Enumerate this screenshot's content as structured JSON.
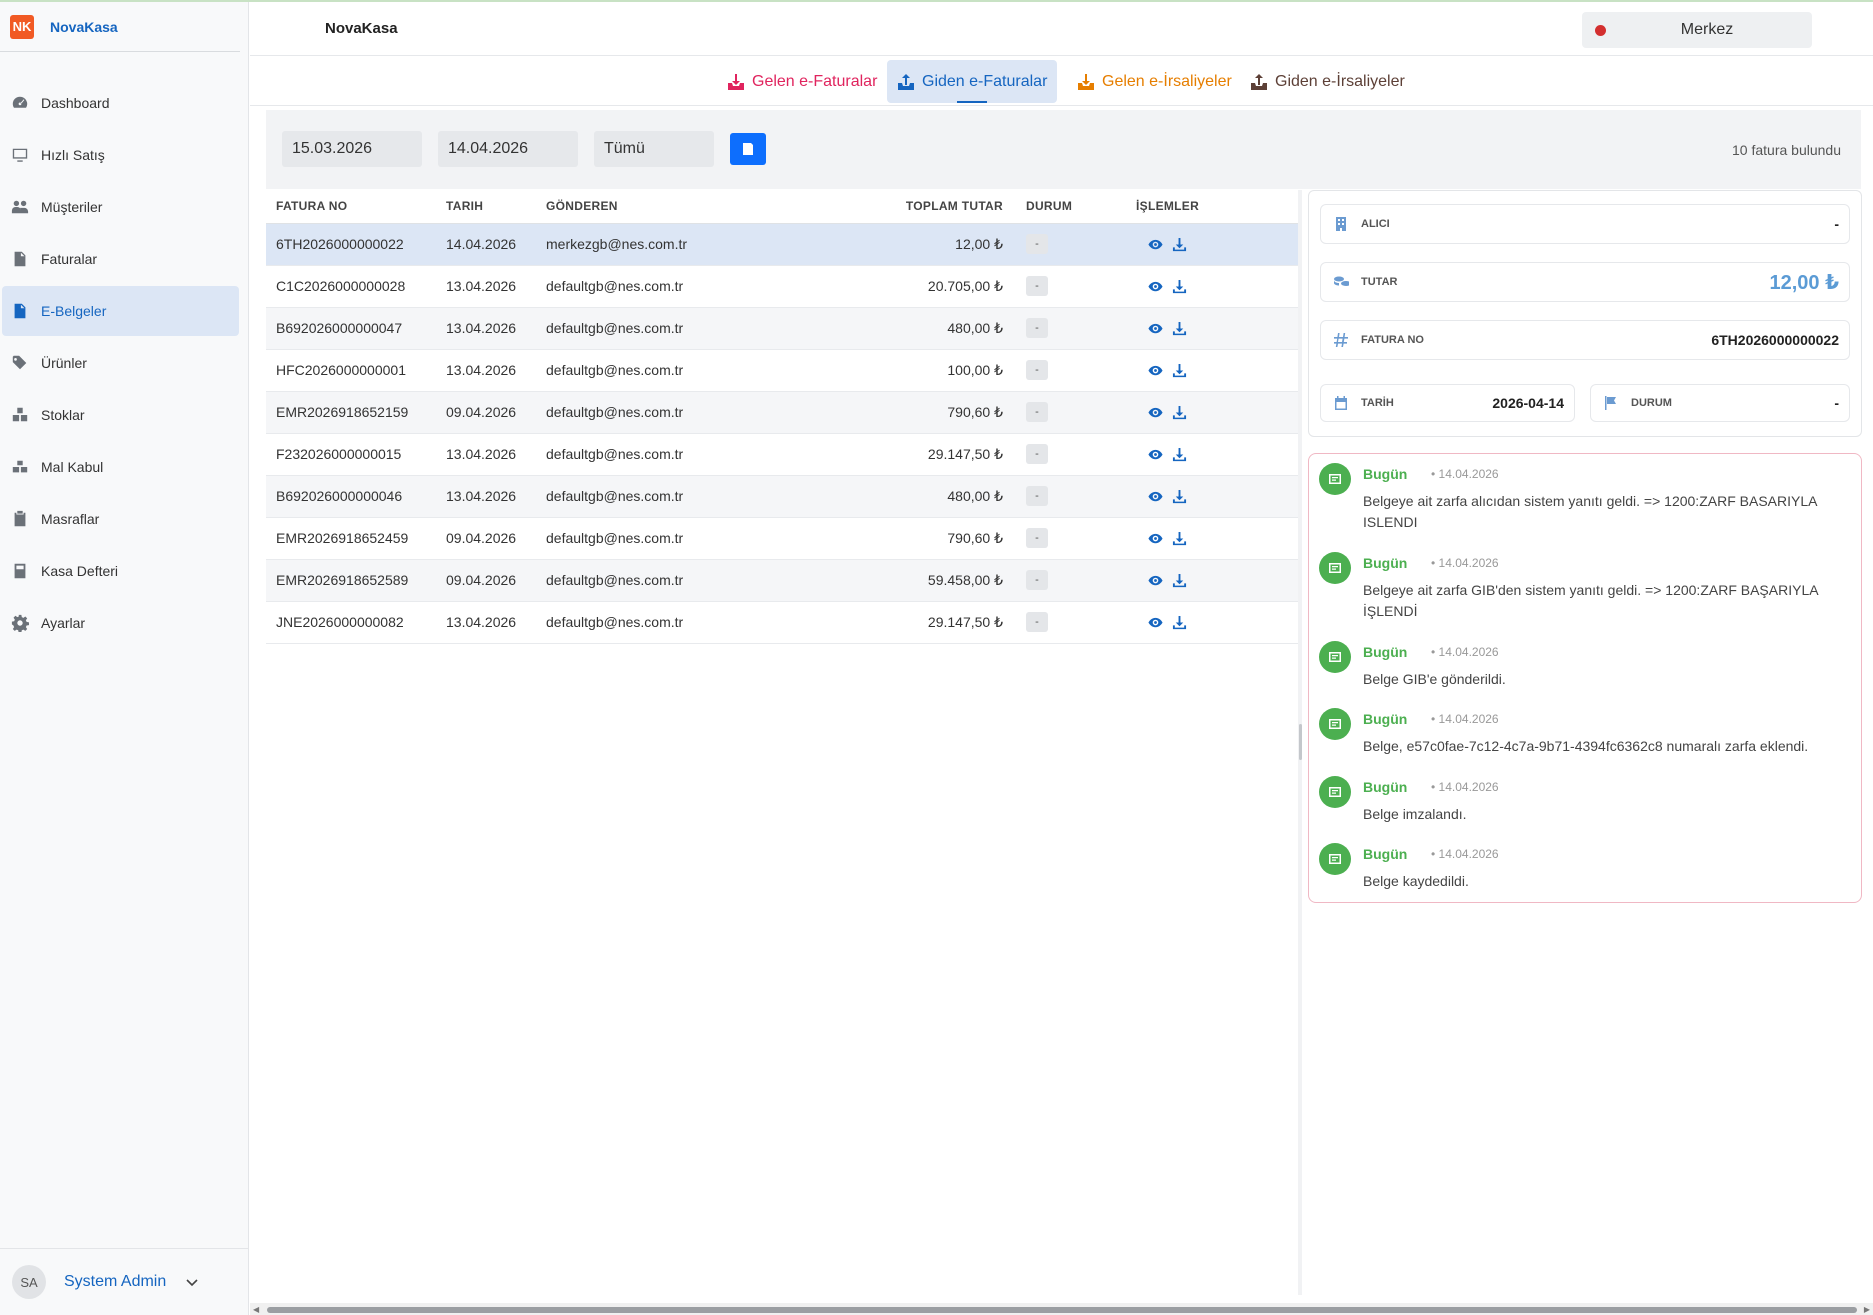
{
  "app": {
    "brand_logo": "NK",
    "brand_name": "NovaKasa",
    "header_title": "NovaKasa",
    "branch": "Merkez"
  },
  "sidebar": {
    "items": [
      {
        "label": "Dashboard",
        "icon": "gauge-icon"
      },
      {
        "label": "Hızlı Satış",
        "icon": "monitor-icon"
      },
      {
        "label": "Müşteriler",
        "icon": "users-icon"
      },
      {
        "label": "Faturalar",
        "icon": "document-icon"
      },
      {
        "label": "E-Belgeler",
        "icon": "e-document-icon",
        "active": true
      },
      {
        "label": "Ürünler",
        "icon": "tags-icon"
      },
      {
        "label": "Stoklar",
        "icon": "boxes-icon"
      },
      {
        "label": "Mal Kabul",
        "icon": "truck-boxes-icon"
      },
      {
        "label": "Masraflar",
        "icon": "clipboard-icon"
      },
      {
        "label": "Kasa Defteri",
        "icon": "book-icon"
      },
      {
        "label": "Ayarlar",
        "icon": "gear-icon"
      }
    ],
    "user": {
      "initials": "SA",
      "name": "System Admin"
    }
  },
  "tabs": [
    {
      "label": "Gelen e-Faturalar",
      "color": "#e0245e"
    },
    {
      "label": "Giden e-Faturalar",
      "color": "#1565c0",
      "active": true
    },
    {
      "label": "Gelen e-İrsaliyeler",
      "color": "#e67e00"
    },
    {
      "label": "Giden e-İrsaliyeler",
      "color": "#5d4037"
    }
  ],
  "filters": {
    "date_from": "15.03.2026",
    "date_to": "14.04.2026",
    "status": "Tümü",
    "result_count": "10 fatura bulundu"
  },
  "table": {
    "headers": [
      "FATURA NO",
      "TARIH",
      "GÖNDEREN",
      "TOPLAM TUTAR",
      "DURUM",
      "İŞLEMLER"
    ],
    "rows": [
      {
        "no": "6TH2026000000022",
        "date": "14.04.2026",
        "sender": "merkezgb@nes.com.tr",
        "amount": "12,00 ₺",
        "status": "-"
      },
      {
        "no": "C1C2026000000028",
        "date": "13.04.2026",
        "sender": "defaultgb@nes.com.tr",
        "amount": "20.705,00 ₺",
        "status": "-"
      },
      {
        "no": "B692026000000047",
        "date": "13.04.2026",
        "sender": "defaultgb@nes.com.tr",
        "amount": "480,00 ₺",
        "status": "-"
      },
      {
        "no": "HFC2026000000001",
        "date": "13.04.2026",
        "sender": "defaultgb@nes.com.tr",
        "amount": "100,00 ₺",
        "status": "-"
      },
      {
        "no": "EMR2026918652159",
        "date": "09.04.2026",
        "sender": "defaultgb@nes.com.tr",
        "amount": "790,60 ₺",
        "status": "-"
      },
      {
        "no": "F232026000000015",
        "date": "13.04.2026",
        "sender": "defaultgb@nes.com.tr",
        "amount": "29.147,50 ₺",
        "status": "-"
      },
      {
        "no": "B692026000000046",
        "date": "13.04.2026",
        "sender": "defaultgb@nes.com.tr",
        "amount": "480,00 ₺",
        "status": "-"
      },
      {
        "no": "EMR2026918652459",
        "date": "09.04.2026",
        "sender": "defaultgb@nes.com.tr",
        "amount": "790,60 ₺",
        "status": "-"
      },
      {
        "no": "EMR2026918652589",
        "date": "09.04.2026",
        "sender": "defaultgb@nes.com.tr",
        "amount": "59.458,00 ₺",
        "status": "-"
      },
      {
        "no": "JNE2026000000082",
        "date": "13.04.2026",
        "sender": "defaultgb@nes.com.tr",
        "amount": "29.147,50 ₺",
        "status": "-"
      }
    ]
  },
  "detail": {
    "alici_label": "ALICI",
    "alici_value": "-",
    "tutar_label": "TUTAR",
    "tutar_value": "12,00 ₺",
    "fatura_label": "FATURA NO",
    "fatura_value": "6TH2026000000022",
    "tarih_label": "TARİH",
    "tarih_value": "2026-04-14",
    "durum_label": "DURUM",
    "durum_value": "-"
  },
  "timeline": [
    {
      "day": "Bugün",
      "date": "• 14.04.2026",
      "text": "Belgeye ait zarfa alıcıdan sistem yanıtı geldi. => 1200:ZARF BASARIYLA ISLENDI"
    },
    {
      "day": "Bugün",
      "date": "• 14.04.2026",
      "text": "Belgeye ait zarfa GIB'den sistem yanıtı geldi. => 1200:ZARF BAŞARIYLA İŞLENDİ"
    },
    {
      "day": "Bugün",
      "date": "• 14.04.2026",
      "text": "Belge GIB'e gönderildi."
    },
    {
      "day": "Bugün",
      "date": "• 14.04.2026",
      "text": "Belge, e57c0fae-7c12-4c7a-9b71-4394fc6362c8 numaralı zarfa eklendi."
    },
    {
      "day": "Bugün",
      "date": "• 14.04.2026",
      "text": "Belge imzalandı."
    },
    {
      "day": "Bugün",
      "date": "• 14.04.2026",
      "text": "Belge kaydedildi."
    }
  ]
}
